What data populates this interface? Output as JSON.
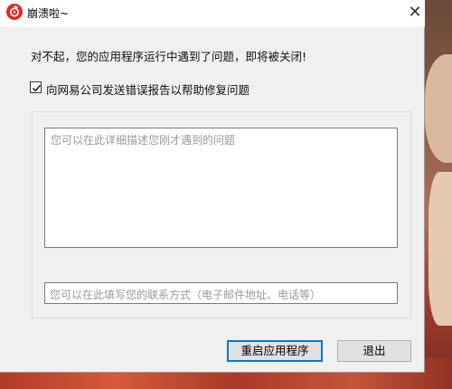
{
  "window": {
    "title": "崩溃啦~",
    "close_glyph": "✕",
    "icon": "netease-music-icon"
  },
  "dialog": {
    "message": "对不起，您的应用程序运行中遇到了问题，即将被关闭!",
    "report_checkbox": {
      "label": "向网易公司发送错误报告以帮助修复问题",
      "checked": true
    },
    "description_placeholder": "您可以在此详细描述您刚才遇到的问题",
    "contact_placeholder": "您可以在此填写您的联系方式（电子邮件地址、电话等）"
  },
  "buttons": {
    "restart_label": "重启应用程序",
    "exit_label": "退出"
  },
  "colors": {
    "accent": "#0078d7",
    "app_icon": "#e0292b",
    "dialog_bg": "#f0f0f0"
  }
}
